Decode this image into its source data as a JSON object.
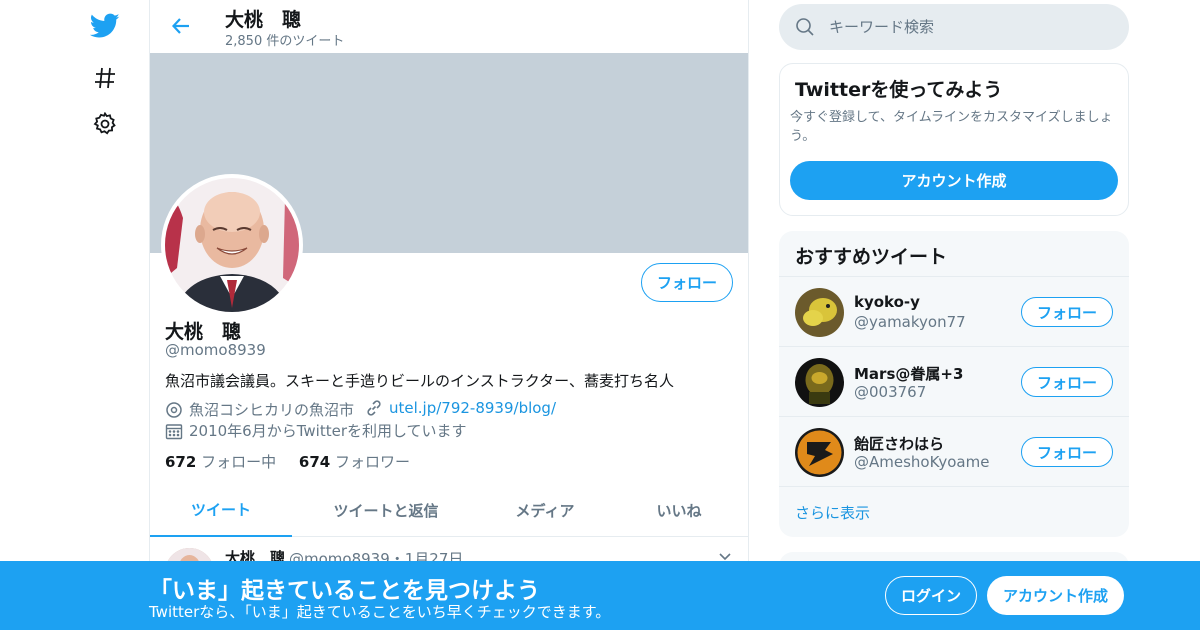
{
  "nav": {
    "logo_icon": "twitter-bird-icon",
    "explore_icon": "hashtag-icon",
    "settings_icon": "gear-icon"
  },
  "header": {
    "name": "大桃　聰",
    "tweet_count": "2,850 件のツイート"
  },
  "profile": {
    "follow_label": "フォロー",
    "name": "大桃　聰",
    "handle": "@momo8939",
    "bio": "魚沼市議会議員。スキーと手造りビールのインストラクター、蕎麦打ち名人",
    "location": "魚沼コシヒカリの魚沼市",
    "url": "utel.jp/792-8939/blog/",
    "joined": "2010年6月からTwitterを利用しています",
    "following_count": "672",
    "following_label": "フォロー中",
    "followers_count": "674",
    "followers_label": "フォロワー"
  },
  "tabs": [
    {
      "label": "ツイート",
      "active": true
    },
    {
      "label": "ツイートと返信",
      "active": false
    },
    {
      "label": "メディア",
      "active": false
    },
    {
      "label": "いいね",
      "active": false
    }
  ],
  "tweet_peek": {
    "name": "大桃　聰",
    "meta": "@momo8939・1月27日"
  },
  "search": {
    "placeholder": "キーワード検索"
  },
  "signup_card": {
    "title": "Twitterを使ってみよう",
    "description": "今すぐ登録して、タイムラインをカスタマイズしましょう。",
    "button": "アカウント作成"
  },
  "recommendations": {
    "title": "おすすめツイート",
    "items": [
      {
        "name": "kyoko-y",
        "handle": "@yamakyon77",
        "follow": "フォロー"
      },
      {
        "name": "Mars@眷属+3",
        "handle": "@003767",
        "follow": "フォロー"
      },
      {
        "name": "飴匠さわはら",
        "handle": "@AmeshoKyoame",
        "follow": "フォロー"
      }
    ],
    "show_more": "さらに表示"
  },
  "bottom_bar": {
    "title": "「いま」起きていることを見つけよう",
    "subtitle": "Twitterなら、「いま」起きていることをいち早くチェックできます。",
    "login": "ログイン",
    "signup": "アカウント作成"
  },
  "colors": {
    "accent": "#1da1f2",
    "banner": "#c5d0d9",
    "secondary_text": "#657786"
  }
}
